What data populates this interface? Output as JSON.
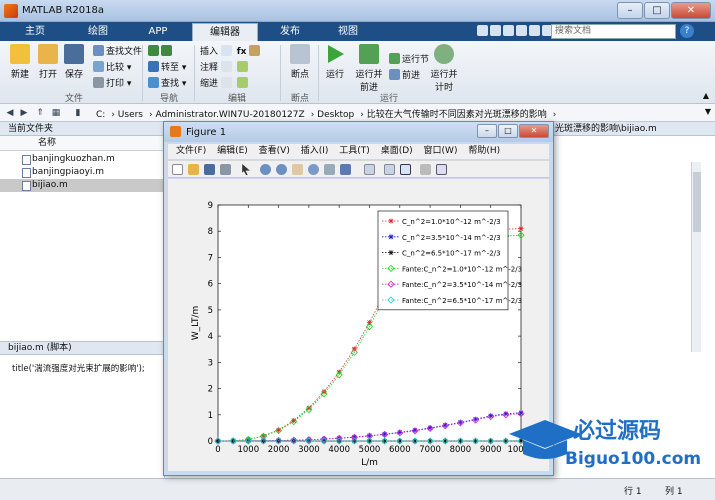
{
  "window": {
    "title": "MATLAB R2018a"
  },
  "tabs": [
    "主页",
    "绘图",
    "APP",
    "编辑器",
    "发布",
    "视图"
  ],
  "search_placeholder": "搜索文档",
  "ribbon": {
    "file": {
      "new": "新建",
      "open": "打开",
      "save": "保存",
      "find_files": "查找文件",
      "compare": "比较",
      "print": "打印",
      "group": "文件"
    },
    "navigate": {
      "goto": "转至",
      "find": "查找",
      "group": "导航"
    },
    "edit": {
      "insert": "插入",
      "comment": "注释",
      "indent": "缩进",
      "group": "编辑"
    },
    "breakpoints": {
      "label": "断点",
      "group": "断点"
    },
    "run": {
      "run": "运行",
      "run_advance": "运行并\n前进",
      "run_section": "运行节",
      "advance": "前进",
      "run_time": "运行并\n计时",
      "group": "运行"
    }
  },
  "address": [
    "C:",
    "Users",
    "Administrator.WIN7U-20180127Z",
    "Desktop",
    "比较在大气传输时不同因素对光斑漂移的影响"
  ],
  "left_panel": {
    "header": "当前文件夹",
    "column": "名称",
    "files": [
      "banjingkuozhan.m",
      "banjingpiaoyi.m",
      "bijiao.m"
    ],
    "selected": "bijiao.m",
    "details_title": "bijiao.m (脚本)",
    "script_preview": "title('湍流强度对光束扩展的影响');"
  },
  "right_panel": {
    "header": "光斑漂移的影响\\bijiao.m"
  },
  "status": {
    "row": "行 1",
    "col": "列 1"
  },
  "figure": {
    "title": "Figure 1",
    "menu": [
      "文件(F)",
      "编辑(E)",
      "查看(V)",
      "插入(I)",
      "工具(T)",
      "桌面(D)",
      "窗口(W)",
      "帮助(H)"
    ]
  },
  "chart_data": {
    "type": "line",
    "xlabel": "L/m",
    "ylabel": "W_LT/m",
    "xlim": [
      0,
      10000
    ],
    "ylim": [
      0,
      9
    ],
    "xticks": [
      0,
      1000,
      2000,
      3000,
      4000,
      5000,
      6000,
      7000,
      8000,
      9000,
      10000
    ],
    "yticks": [
      0,
      1,
      2,
      3,
      4,
      5,
      6,
      7,
      8,
      9
    ],
    "x": [
      0,
      500,
      1000,
      1500,
      2000,
      2500,
      3000,
      3500,
      4000,
      4500,
      5000,
      5500,
      6000,
      6500,
      7000,
      7500,
      8000,
      8500,
      9000,
      9500,
      10000
    ],
    "legend_position": "top-right",
    "series": [
      {
        "name": "C_n^2=1.0*10^-12 m^-2/3",
        "color": "#d62728",
        "marker": "*",
        "values": [
          0,
          0.01,
          0.06,
          0.19,
          0.42,
          0.78,
          1.26,
          1.88,
          2.63,
          3.51,
          4.52,
          5.65,
          6.9,
          7.3,
          7.6,
          7.8,
          7.9,
          8.0,
          8.05,
          8.08,
          8.1
        ]
      },
      {
        "name": "C_n^2=3.5*10^-14 m^-2/3",
        "color": "#1f1fd0",
        "marker": "*",
        "values": [
          0,
          0,
          0.01,
          0.01,
          0.02,
          0.03,
          0.05,
          0.08,
          0.11,
          0.15,
          0.2,
          0.26,
          0.33,
          0.41,
          0.5,
          0.6,
          0.71,
          0.83,
          0.96,
          1.04,
          1.08
        ]
      },
      {
        "name": "C_n^2=6.5*10^-17 m^-2/3",
        "color": "#111111",
        "marker": "*",
        "values": [
          0,
          0,
          0,
          0,
          0,
          0,
          0,
          0,
          0,
          0,
          0,
          0,
          0,
          0,
          0,
          0,
          0,
          0,
          0,
          0,
          0.01
        ]
      },
      {
        "name": "Fante:C_n^2=1.0*10^-12 m^-2/3",
        "color": "#22cc22",
        "marker": "diamond",
        "values": [
          0,
          0.01,
          0.06,
          0.18,
          0.4,
          0.74,
          1.2,
          1.8,
          2.52,
          3.38,
          4.36,
          5.48,
          6.72,
          7.1,
          7.4,
          7.55,
          7.65,
          7.72,
          7.78,
          7.82,
          7.85
        ]
      },
      {
        "name": "Fante:C_n^2=3.5*10^-14 m^-2/3",
        "color": "#cc22cc",
        "marker": "diamond",
        "values": [
          0,
          0,
          0.01,
          0.01,
          0.02,
          0.03,
          0.05,
          0.07,
          0.1,
          0.14,
          0.19,
          0.25,
          0.31,
          0.39,
          0.48,
          0.58,
          0.69,
          0.8,
          0.93,
          1.0,
          1.04
        ]
      },
      {
        "name": "Fante:C_n^2=6.5*10^-17 m^-2/3",
        "color": "#22cccc",
        "marker": "diamond",
        "values": [
          0,
          0,
          0,
          0,
          0,
          0,
          0,
          0,
          0,
          0,
          0,
          0,
          0,
          0,
          0,
          0,
          0,
          0,
          0,
          0,
          0
        ]
      }
    ]
  },
  "watermark": {
    "title": "必过源码",
    "url": "Biguo100.com"
  }
}
